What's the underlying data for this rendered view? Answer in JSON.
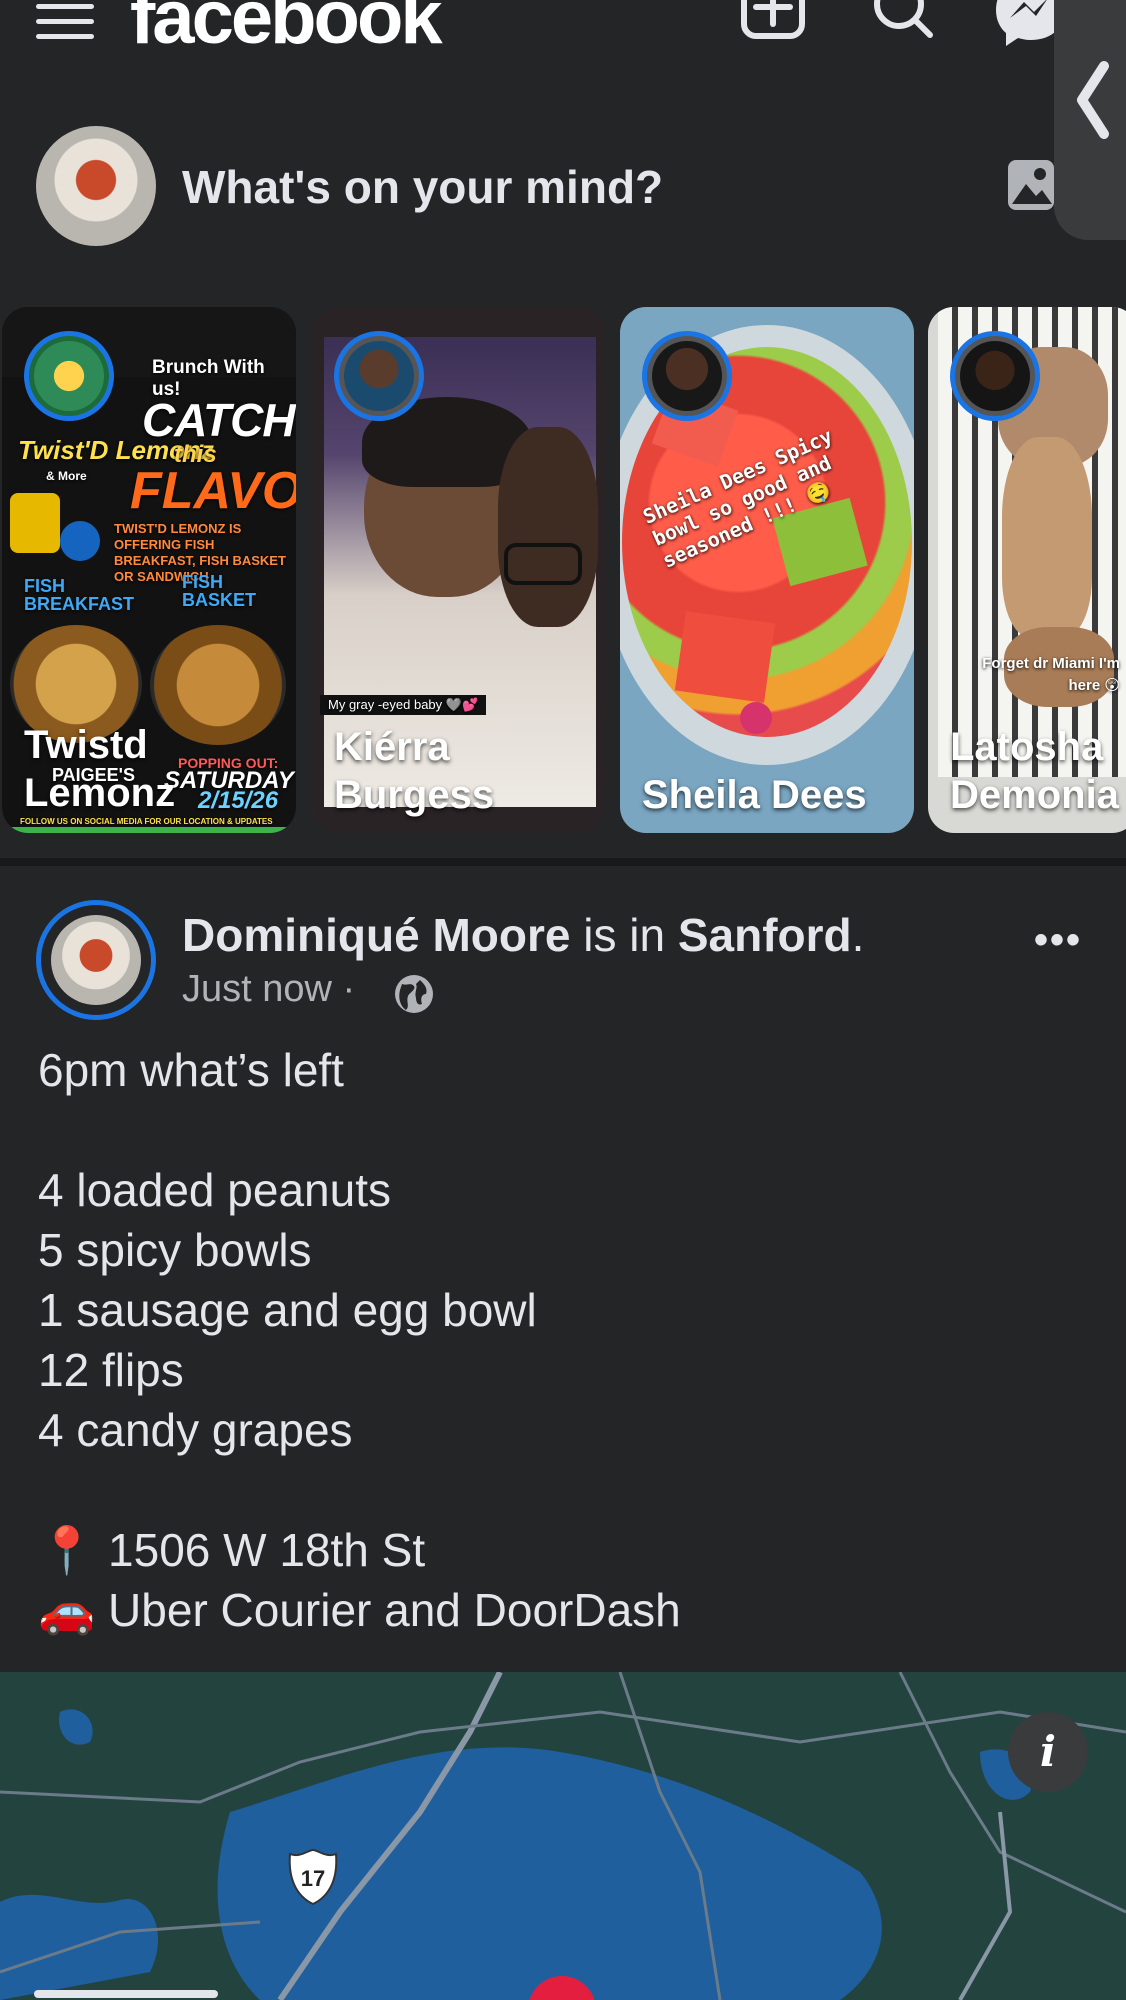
{
  "app": {
    "logo": "facebook"
  },
  "composer": {
    "placeholder": "What's on your mind?"
  },
  "stories": [
    {
      "name": "Twistd Lemonz",
      "line1": "Twistd",
      "line2": "Lemonz"
    },
    {
      "name": "Kiérra Burgess",
      "line1": "Kiérra",
      "line2": "Burgess",
      "caption": "My gray -eyed baby 🩶💕"
    },
    {
      "name": "Sheila Dees",
      "line1": "Sheila Dees",
      "line2": "",
      "caption": "Sheila Dees Spicy bowl so good and seasoned !!! 🤤"
    },
    {
      "name": "Latosha Demonia",
      "line1": "Latosha",
      "line2": "Demonia",
      "caption": "Forget dr Miami I'm here 😲"
    }
  ],
  "story_flyer": {
    "top": "Brunch With us!",
    "brand": "Twist'D Lemonz",
    "brand_sub": "& More",
    "headline1": "CATCH",
    "headline2": "this",
    "headline3": "FLAVOR!",
    "offer": "TWIST'D LEMONZ IS OFFERING FISH BREAKFAST, FISH BASKET OR SANDWICH",
    "left_label": "FISH BREAKFAST",
    "right_label": "FISH BASKET",
    "popping": "POPPING OUT:",
    "day": "SATURDAY",
    "date": "2/15/26",
    "place": "PAIGEE'S",
    "follow": "FOLLOW US ON SOCIAL MEDIA FOR OUR LOCATION & UPDATES"
  },
  "post": {
    "author": "Dominiqué Moore",
    "is_in": " is in ",
    "location": "Sanford",
    "period": ".",
    "time": "Just now",
    "dot": "·",
    "more": "•••",
    "body_lines": [
      "6pm what’s left",
      "",
      "4 loaded peanuts",
      "5 spicy bowls",
      "1 sausage and egg bowl",
      "12 flips",
      "4 candy grapes",
      "",
      "📍 1506 W 18th St",
      "🚗 Uber Courier and DoorDash"
    ]
  },
  "map": {
    "route_shield": "17",
    "info_icon": "i"
  },
  "icons": {
    "menu": "hamburger-icon",
    "create": "plus-square-icon",
    "search": "search-icon",
    "messenger": "messenger-icon",
    "photo": "photo-icon",
    "globe": "globe-icon",
    "handle": "chevron-left-icon"
  },
  "colors": {
    "background": "#242526",
    "accent": "#1b74e4",
    "text": "#e4e6eb",
    "secondary": "#b0b3b8"
  }
}
